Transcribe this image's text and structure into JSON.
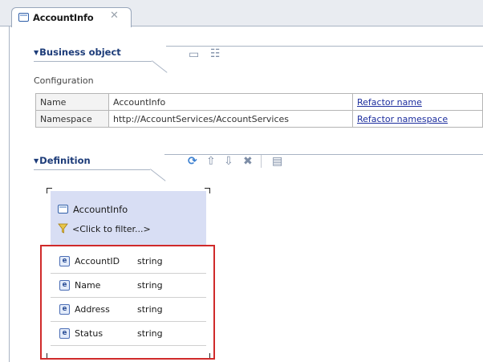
{
  "editor_tab": {
    "title": "AccountInfo",
    "close_glyph": "✕"
  },
  "business_object_section": {
    "title": "Business object",
    "toolbar": [
      {
        "name": "table-view-icon",
        "glyph": "▭"
      },
      {
        "name": "tree-view-icon",
        "glyph": "☷"
      }
    ],
    "configuration_label": "Configuration",
    "rows": [
      {
        "label": "Name",
        "value": "AccountInfo",
        "action": "Refactor name"
      },
      {
        "label": "Namespace",
        "value": "http://AccountServices/AccountServices",
        "action": "Refactor namespace"
      }
    ]
  },
  "definition_section": {
    "title": "Definition",
    "toolbar": [
      {
        "name": "add-field-icon",
        "glyph": "⟳",
        "color": "#3a7fd0"
      },
      {
        "name": "move-up-icon",
        "glyph": "⇧"
      },
      {
        "name": "move-down-icon",
        "glyph": "⇩"
      },
      {
        "name": "delete-icon",
        "glyph": "✖"
      },
      {
        "name": "properties-icon",
        "glyph": "▤"
      }
    ],
    "business_object": {
      "name": "AccountInfo",
      "filter_text": "<Click to filter...>",
      "field_icon_glyph": "e",
      "fields": [
        {
          "name": "AccountID",
          "type": "string"
        },
        {
          "name": "Name",
          "type": "string"
        },
        {
          "name": "Address",
          "type": "string"
        },
        {
          "name": "Status",
          "type": "string"
        }
      ]
    }
  },
  "colors": {
    "section_title": "#1d3c79",
    "highlight_box": "#d02a2a",
    "link": "#1d2e9e",
    "bo_header": "#d8def4"
  }
}
